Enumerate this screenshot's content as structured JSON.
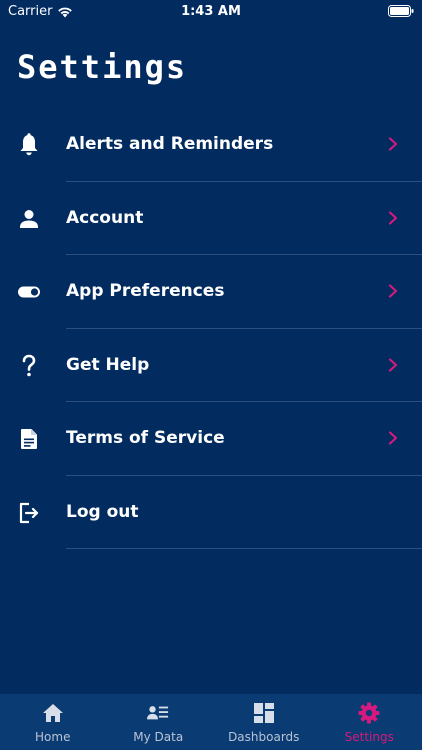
{
  "status_bar": {
    "carrier": "Carrier",
    "time": "1:43 AM"
  },
  "page": {
    "title": "Settings"
  },
  "settings_items": [
    {
      "label": "Alerts and Reminders",
      "icon": "bell-icon",
      "has_chevron": true
    },
    {
      "label": "Account",
      "icon": "person-icon",
      "has_chevron": true
    },
    {
      "label": "App Preferences",
      "icon": "toggle-icon",
      "has_chevron": true
    },
    {
      "label": "Get Help",
      "icon": "question-icon",
      "has_chevron": true
    },
    {
      "label": "Terms of Service",
      "icon": "document-icon",
      "has_chevron": true
    },
    {
      "label": "Log out",
      "icon": "logout-icon",
      "has_chevron": false
    }
  ],
  "tab_bar": {
    "tabs": [
      {
        "label": "Home",
        "icon": "home-icon",
        "active": false
      },
      {
        "label": "My Data",
        "icon": "my-data-icon",
        "active": false
      },
      {
        "label": "Dashboards",
        "icon": "dashboard-icon",
        "active": false
      },
      {
        "label": "Settings",
        "icon": "gear-icon",
        "active": true
      }
    ]
  },
  "colors": {
    "background": "#022b60",
    "tab_bar": "#0a3b72",
    "accent": "#d6197e",
    "divider": "#2c4f7e",
    "inactive_tab": "#b8c4d6"
  }
}
